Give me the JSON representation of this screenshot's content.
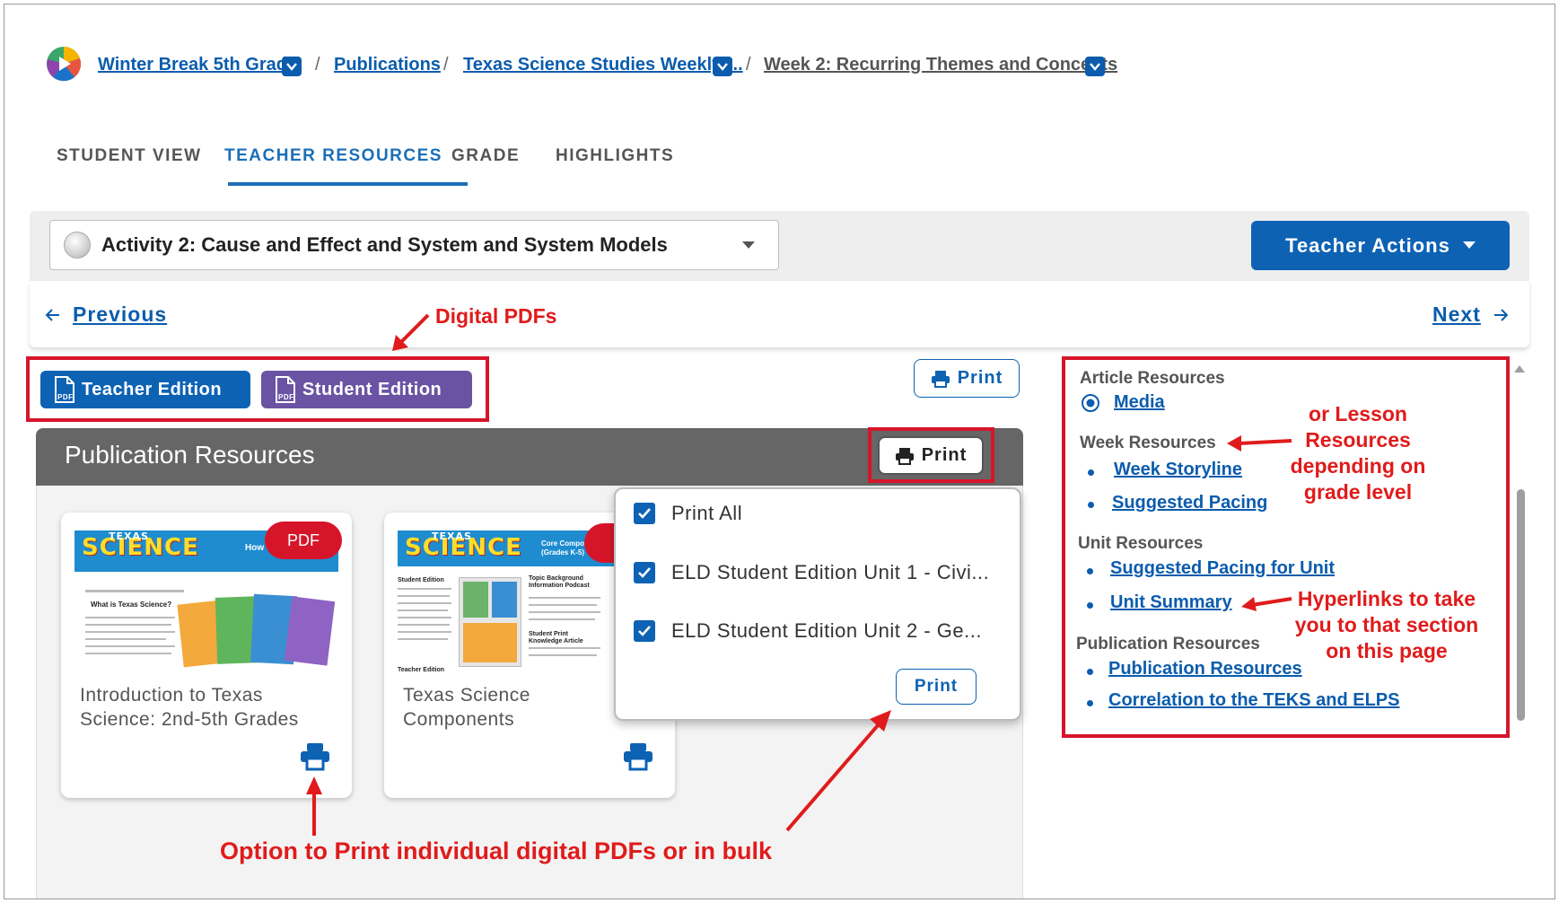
{
  "breadcrumb": {
    "items": [
      {
        "label": "Winter Break 5th Grade"
      },
      {
        "label": "Publications"
      },
      {
        "label": "Texas Science Studies Weekly:..."
      },
      {
        "label": "Week 2: Recurring Themes and Concepts"
      }
    ],
    "separator": "/"
  },
  "tabs": [
    {
      "label": "STUDENT VIEW"
    },
    {
      "label": "TEACHER RESOURCES",
      "active": true
    },
    {
      "label": "GRADE"
    },
    {
      "label": "HIGHLIGHTS"
    }
  ],
  "activity": {
    "selected": "Activity 2: Cause and Effect and System and System Models",
    "teacher_actions": "Teacher Actions"
  },
  "nav": {
    "previous": "Previous",
    "next": "Next"
  },
  "editions": {
    "teacher": "Teacher Edition",
    "student": "Student Edition",
    "pdf_mark": "PDF"
  },
  "print_label": "Print",
  "publication_resources": {
    "title": "Publication Resources",
    "print": "Print",
    "cards": [
      {
        "title_line1": "Introduction to Texas",
        "title_line2": "Science: 2nd-5th Grades",
        "badge": "PDF",
        "thumb_logo": "SCIENCE",
        "thumb_logo_small": "TEXAS",
        "thumb_header": "How Studies Weekly",
        "thumb_sub": "What is Texas Science?"
      },
      {
        "title_line1": "Texas Science",
        "title_line2": "Components",
        "thumb_logo": "SCIENCE",
        "thumb_logo_small": "TEXAS",
        "thumb_header": "Core Component (Grades K-5)",
        "thumb_sub1": "Student Edition",
        "thumb_sub2": "Topic Background Information Podcast",
        "thumb_sub3": "Student Print Knowledge Article",
        "thumb_sub4": "Teacher Edition"
      }
    ],
    "print_menu": {
      "options": [
        {
          "label": "Print All",
          "checked": true
        },
        {
          "label": "ELD Student Edition Unit 1 - Civi...",
          "checked": true
        },
        {
          "label": "ELD Student Edition Unit 2 - Ge...",
          "checked": true
        }
      ],
      "print_button": "Print"
    }
  },
  "right_panel": {
    "article_resources": {
      "heading": "Article Resources",
      "links": [
        "Media"
      ]
    },
    "week_resources": {
      "heading": "Week Resources",
      "links": [
        "Week Storyline",
        "Suggested Pacing"
      ]
    },
    "unit_resources": {
      "heading": "Unit Resources",
      "links": [
        "Suggested Pacing for Unit",
        "Unit Summary"
      ]
    },
    "publication_resources": {
      "heading": "Publication Resources",
      "links": [
        "Publication Resources",
        "Correlation to the TEKS and ELPS"
      ]
    }
  },
  "annotations": {
    "digital_pdfs": "Digital PDFs",
    "lesson_line1": "or Lesson",
    "lesson_line2": "Resources",
    "lesson_line3": "depending on",
    "lesson_line4": "grade level",
    "hyper_line1": "Hyperlinks to take",
    "hyper_line2": "you to that section",
    "hyper_line3": "on this page",
    "print_option": "Option to Print individual digital PDFs or in bulk"
  },
  "colors": {
    "primary": "#0d62b4",
    "student_edition": "#6a53a3",
    "annotation_red": "#e01b1b",
    "header_gray": "#666666"
  },
  "icons": [
    "app-logo-icon",
    "chevron-down-icon",
    "arrow-left-icon",
    "arrow-right-icon",
    "pdf-file-icon",
    "printer-icon",
    "radio-icon",
    "checkbox-icon"
  ]
}
